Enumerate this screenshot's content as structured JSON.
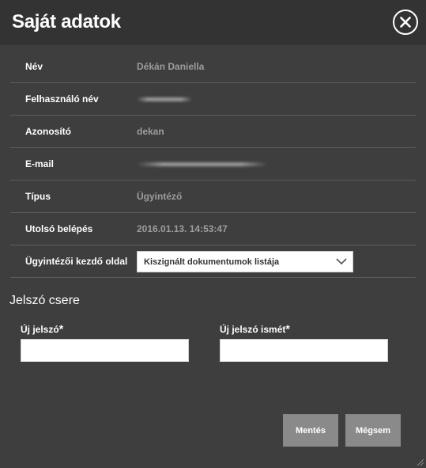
{
  "dialog": {
    "title": "Saját adatok",
    "close_icon": "close-circle-icon"
  },
  "fields": [
    {
      "label": "Név",
      "value": "Dékán Daniella"
    },
    {
      "label": "Felhasználó név",
      "value": null,
      "redacted": true
    },
    {
      "label": "Azonosító",
      "value": "dekan"
    },
    {
      "label": "E-mail",
      "value": null,
      "redacted": true
    },
    {
      "label": "Típus",
      "value": "Ügyintéző"
    },
    {
      "label": "Utolsó belépés",
      "value": "2016.01.13. 14:53:47"
    },
    {
      "label": "Ügyintézői kezdő oldal",
      "value": "Kiszignált dokumentumok listája"
    }
  ],
  "password": {
    "section_title": "Jelszó csere",
    "new_label": "Új jelszó",
    "repeat_label": "Új jelszó ismét",
    "required_mark": "*",
    "new_value": "",
    "repeat_value": ""
  },
  "buttons": {
    "save": "Mentés",
    "cancel": "Mégsem"
  },
  "colors": {
    "background": "#3e3e3e",
    "titlebar": "#333333",
    "value_text": "#9d9d9d",
    "button": "#8a8a8a"
  }
}
